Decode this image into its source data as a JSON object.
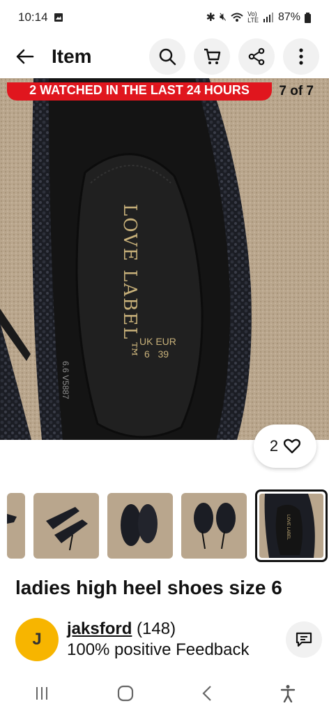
{
  "status": {
    "time": "10:14",
    "battery": "87%"
  },
  "appbar": {
    "title": "Item"
  },
  "banner": {
    "text": "2 WATCHED IN THE LAST 24 HOURS",
    "counter": "7 of 7"
  },
  "hero": {
    "insole_brand": "LOVE LABEL™",
    "size_header": "UK EUR",
    "size_values": "6   39",
    "model_code": "6.6 V5887"
  },
  "watch": {
    "count": "2"
  },
  "item": {
    "title": "ladies high heel shoes size 6"
  },
  "seller": {
    "initial": "J",
    "name": "jaksford",
    "rating": "(148)",
    "feedback": "100% positive Feedback"
  },
  "colors": {
    "banner": "#e0161e",
    "avatar": "#f7b500"
  }
}
